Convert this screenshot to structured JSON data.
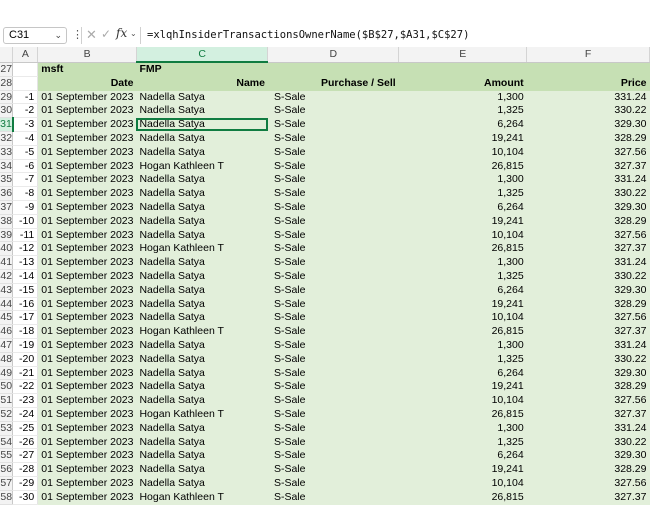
{
  "formula_bar": {
    "name_box": "C31",
    "formula": "=xlqhInsiderTransactionsOwnerName($B$27,$A31,$C$27)"
  },
  "columns": [
    "A",
    "B",
    "C",
    "D",
    "E",
    "F"
  ],
  "header_rows": [
    {
      "row": "27",
      "a": "",
      "b": "msft",
      "c": "FMP",
      "d": "",
      "e": "",
      "f": ""
    },
    {
      "row": "28",
      "a": "",
      "b": "Date",
      "c": "Name",
      "d": "Purchase / Sell",
      "e": "Amount",
      "f": "Price"
    }
  ],
  "rows": [
    {
      "row": "29",
      "a": "-1",
      "b": "01 September 2023",
      "name": "Nadella Satya",
      "type": "S-Sale",
      "amount": "1,300",
      "price": "331.24"
    },
    {
      "row": "30",
      "a": "-2",
      "b": "01 September 2023",
      "name": "Nadella Satya",
      "type": "S-Sale",
      "amount": "1,325",
      "price": "330.22"
    },
    {
      "row": "31",
      "a": "-3",
      "b": "01 September 2023",
      "name": "Nadella Satya",
      "type": "S-Sale",
      "amount": "6,264",
      "price": "329.30"
    },
    {
      "row": "32",
      "a": "-4",
      "b": "01 September 2023",
      "name": "Nadella Satya",
      "type": "S-Sale",
      "amount": "19,241",
      "price": "328.29"
    },
    {
      "row": "33",
      "a": "-5",
      "b": "01 September 2023",
      "name": "Nadella Satya",
      "type": "S-Sale",
      "amount": "10,104",
      "price": "327.56"
    },
    {
      "row": "34",
      "a": "-6",
      "b": "01 September 2023",
      "name": "Hogan Kathleen T",
      "type": "S-Sale",
      "amount": "26,815",
      "price": "327.37"
    },
    {
      "row": "35",
      "a": "-7",
      "b": "01 September 2023",
      "name": "Nadella Satya",
      "type": "S-Sale",
      "amount": "1,300",
      "price": "331.24"
    },
    {
      "row": "36",
      "a": "-8",
      "b": "01 September 2023",
      "name": "Nadella Satya",
      "type": "S-Sale",
      "amount": "1,325",
      "price": "330.22"
    },
    {
      "row": "37",
      "a": "-9",
      "b": "01 September 2023",
      "name": "Nadella Satya",
      "type": "S-Sale",
      "amount": "6,264",
      "price": "329.30"
    },
    {
      "row": "38",
      "a": "-10",
      "b": "01 September 2023",
      "name": "Nadella Satya",
      "type": "S-Sale",
      "amount": "19,241",
      "price": "328.29"
    },
    {
      "row": "39",
      "a": "-11",
      "b": "01 September 2023",
      "name": "Nadella Satya",
      "type": "S-Sale",
      "amount": "10,104",
      "price": "327.56"
    },
    {
      "row": "40",
      "a": "-12",
      "b": "01 September 2023",
      "name": "Hogan Kathleen T",
      "type": "S-Sale",
      "amount": "26,815",
      "price": "327.37"
    },
    {
      "row": "41",
      "a": "-13",
      "b": "01 September 2023",
      "name": "Nadella Satya",
      "type": "S-Sale",
      "amount": "1,300",
      "price": "331.24"
    },
    {
      "row": "42",
      "a": "-14",
      "b": "01 September 2023",
      "name": "Nadella Satya",
      "type": "S-Sale",
      "amount": "1,325",
      "price": "330.22"
    },
    {
      "row": "43",
      "a": "-15",
      "b": "01 September 2023",
      "name": "Nadella Satya",
      "type": "S-Sale",
      "amount": "6,264",
      "price": "329.30"
    },
    {
      "row": "44",
      "a": "-16",
      "b": "01 September 2023",
      "name": "Nadella Satya",
      "type": "S-Sale",
      "amount": "19,241",
      "price": "328.29"
    },
    {
      "row": "45",
      "a": "-17",
      "b": "01 September 2023",
      "name": "Nadella Satya",
      "type": "S-Sale",
      "amount": "10,104",
      "price": "327.56"
    },
    {
      "row": "46",
      "a": "-18",
      "b": "01 September 2023",
      "name": "Hogan Kathleen T",
      "type": "S-Sale",
      "amount": "26,815",
      "price": "327.37"
    },
    {
      "row": "47",
      "a": "-19",
      "b": "01 September 2023",
      "name": "Nadella Satya",
      "type": "S-Sale",
      "amount": "1,300",
      "price": "331.24"
    },
    {
      "row": "48",
      "a": "-20",
      "b": "01 September 2023",
      "name": "Nadella Satya",
      "type": "S-Sale",
      "amount": "1,325",
      "price": "330.22"
    },
    {
      "row": "49",
      "a": "-21",
      "b": "01 September 2023",
      "name": "Nadella Satya",
      "type": "S-Sale",
      "amount": "6,264",
      "price": "329.30"
    },
    {
      "row": "50",
      "a": "-22",
      "b": "01 September 2023",
      "name": "Nadella Satya",
      "type": "S-Sale",
      "amount": "19,241",
      "price": "328.29"
    },
    {
      "row": "51",
      "a": "-23",
      "b": "01 September 2023",
      "name": "Nadella Satya",
      "type": "S-Sale",
      "amount": "10,104",
      "price": "327.56"
    },
    {
      "row": "52",
      "a": "-24",
      "b": "01 September 2023",
      "name": "Hogan Kathleen T",
      "type": "S-Sale",
      "amount": "26,815",
      "price": "327.37"
    },
    {
      "row": "53",
      "a": "-25",
      "b": "01 September 2023",
      "name": "Nadella Satya",
      "type": "S-Sale",
      "amount": "1,300",
      "price": "331.24"
    },
    {
      "row": "54",
      "a": "-26",
      "b": "01 September 2023",
      "name": "Nadella Satya",
      "type": "S-Sale",
      "amount": "1,325",
      "price": "330.22"
    },
    {
      "row": "55",
      "a": "-27",
      "b": "01 September 2023",
      "name": "Nadella Satya",
      "type": "S-Sale",
      "amount": "6,264",
      "price": "329.30"
    },
    {
      "row": "56",
      "a": "-28",
      "b": "01 September 2023",
      "name": "Nadella Satya",
      "type": "S-Sale",
      "amount": "19,241",
      "price": "328.29"
    },
    {
      "row": "57",
      "a": "-29",
      "b": "01 September 2023",
      "name": "Nadella Satya",
      "type": "S-Sale",
      "amount": "10,104",
      "price": "327.56"
    },
    {
      "row": "58",
      "a": "-30",
      "b": "01 September 2023",
      "name": "Hogan Kathleen T",
      "type": "S-Sale",
      "amount": "26,815",
      "price": "327.37"
    }
  ]
}
